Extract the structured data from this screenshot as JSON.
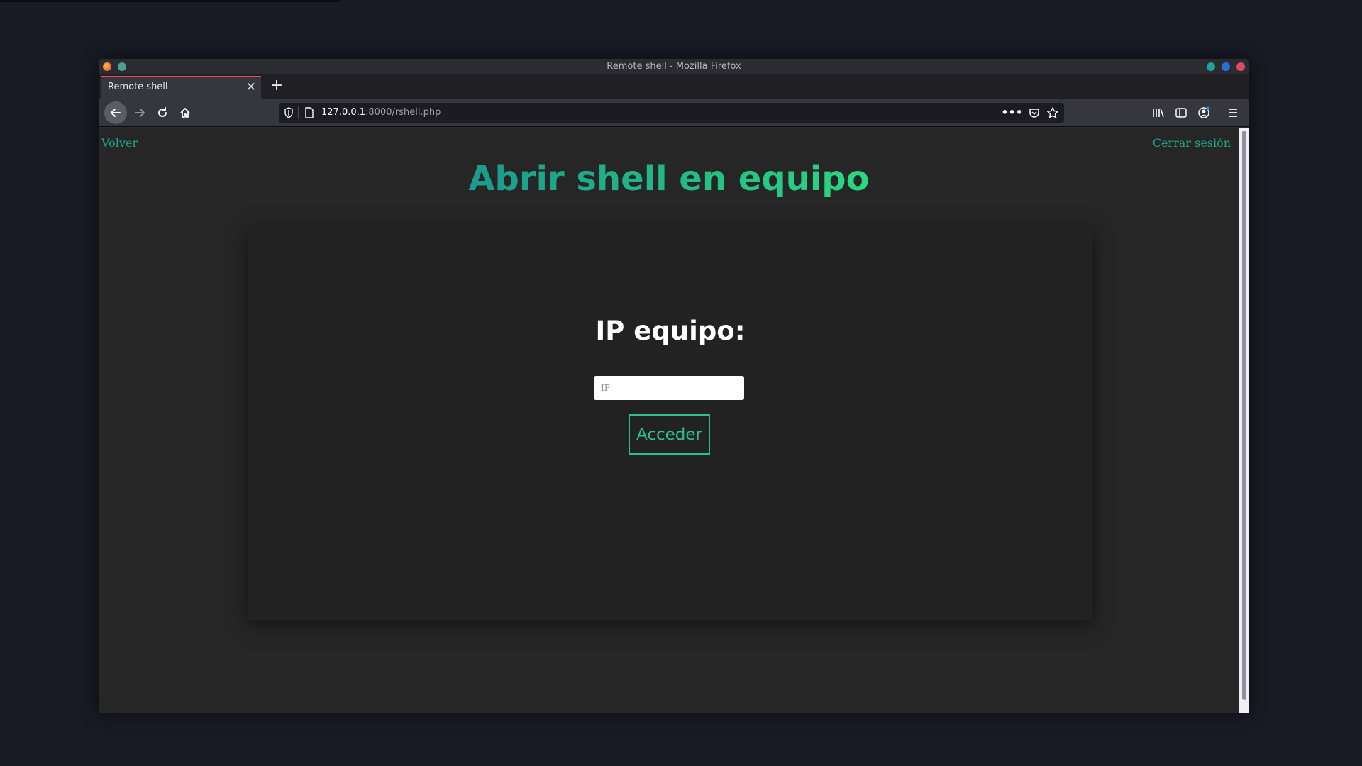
{
  "window": {
    "title": "Remote shell - Mozilla Firefox",
    "controls_colors": [
      "#1aa39a",
      "#2a6fd6",
      "#e5476b"
    ]
  },
  "tabs": [
    {
      "label": "Remote shell",
      "close_icon": "close-icon"
    }
  ],
  "newtab_label": "+",
  "url": {
    "host": "127.0.0.1",
    "rest": ":8000/rshell.php"
  },
  "toolbar_icons": [
    "back-arrow-icon",
    "forward-arrow-icon",
    "reload-icon",
    "home-icon",
    "shield-icon",
    "page-icon",
    "more-icon",
    "pocket-icon",
    "bookmark-star-icon",
    "library-icon",
    "sidebar-icon",
    "account-icon",
    "menu-icon"
  ],
  "page": {
    "back_link": "Volver",
    "logout_link": "Cerrar sesión",
    "title": "Abrir shell en equipo",
    "form": {
      "heading": "IP equipo:",
      "ip_placeholder": "IP",
      "ip_value": "",
      "submit_label": "Acceder"
    }
  },
  "colors": {
    "accent": "#2bc08a",
    "link": "#1fa58a",
    "title_gradient": [
      "#1a9a8c",
      "#2bd87f"
    ],
    "tab_indicator": "#e5476b"
  }
}
